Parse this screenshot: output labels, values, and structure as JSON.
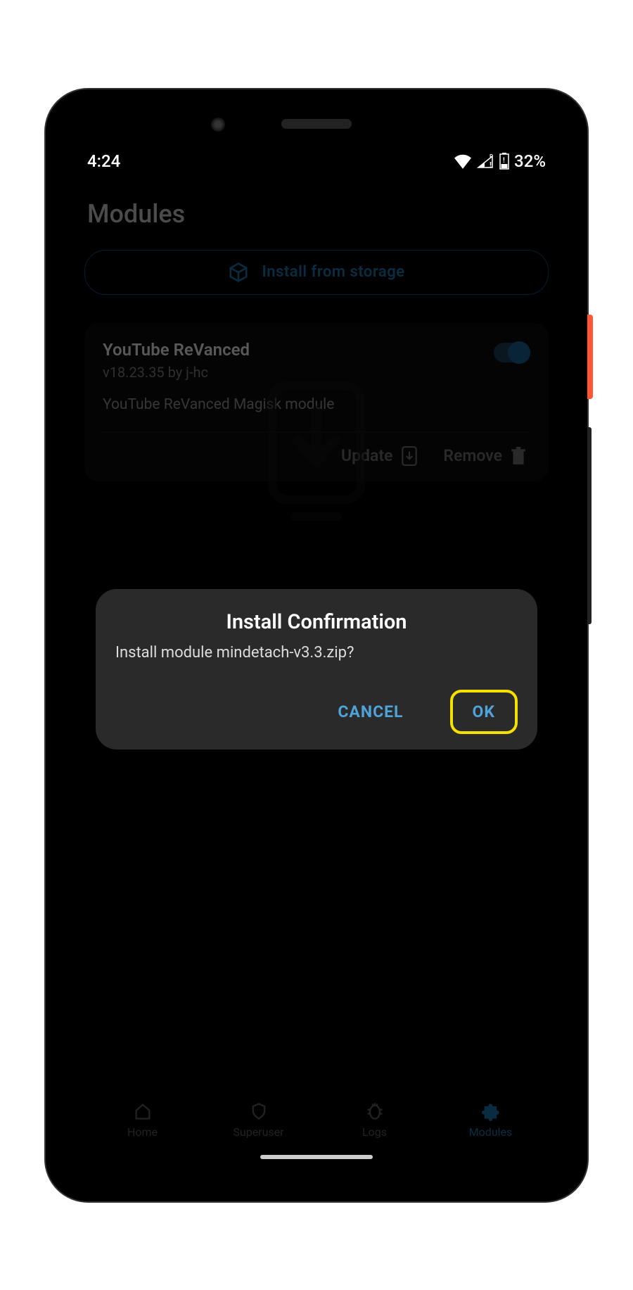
{
  "status": {
    "time": "4:24",
    "battery": "32%",
    "roaming": "R"
  },
  "page": {
    "title": "Modules"
  },
  "install_btn": {
    "label": "Install from storage"
  },
  "module": {
    "title": "YouTube ReVanced",
    "subtitle": "v18.23.35 by j-hc",
    "description": "YouTube ReVanced Magisk module",
    "update_label": "Update",
    "remove_label": "Remove"
  },
  "dialog": {
    "title": "Install Confirmation",
    "message": "Install module mindetach-v3.3.zip?",
    "cancel": "CANCEL",
    "ok": "OK"
  },
  "nav": {
    "home": "Home",
    "superuser": "Superuser",
    "logs": "Logs",
    "modules": "Modules"
  }
}
